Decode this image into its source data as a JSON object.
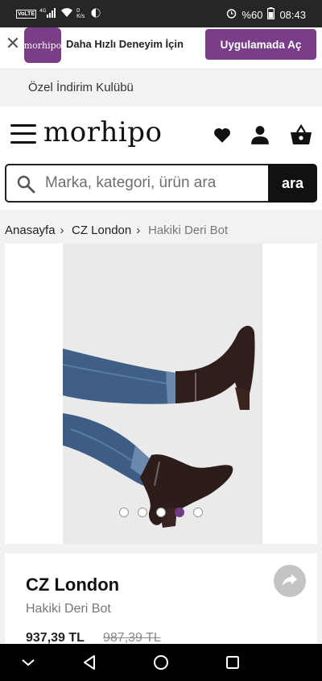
{
  "status_bar": {
    "left_icons": [
      "volte-icon",
      "signal-icon",
      "wifi-icon",
      "data-speed",
      "vpn-icon"
    ],
    "data_speed": "0 K/s",
    "battery": "%60",
    "time": "08:43"
  },
  "app_banner": {
    "logo_text": "morhipo",
    "text": "Daha Hızlı Deneyim İçin",
    "button": "Uygulamada Aç",
    "accent": "#7a3d8a"
  },
  "club": {
    "label": "Özel İndirim Kulübü"
  },
  "header": {
    "logo": "morhipo",
    "icons": [
      "menu-icon",
      "heart-icon",
      "user-icon",
      "basket-icon"
    ]
  },
  "search": {
    "placeholder": "Marka, kategori, ürün ara",
    "value": "",
    "button": "ara"
  },
  "breadcrumb": {
    "items": [
      "Anasayfa",
      "CZ London",
      "Hakiki Deri Bot"
    ],
    "separator": "›"
  },
  "gallery": {
    "total": 5,
    "active_index": 4,
    "active_color": "#6f3a83"
  },
  "product": {
    "brand": "CZ London",
    "name": "Hakiki Deri Bot",
    "price": "937,39 TL",
    "old_price": "987,39 TL"
  },
  "nav_bar": {
    "icons": [
      "collapse-icon",
      "back-icon",
      "home-icon",
      "recents-icon"
    ]
  }
}
